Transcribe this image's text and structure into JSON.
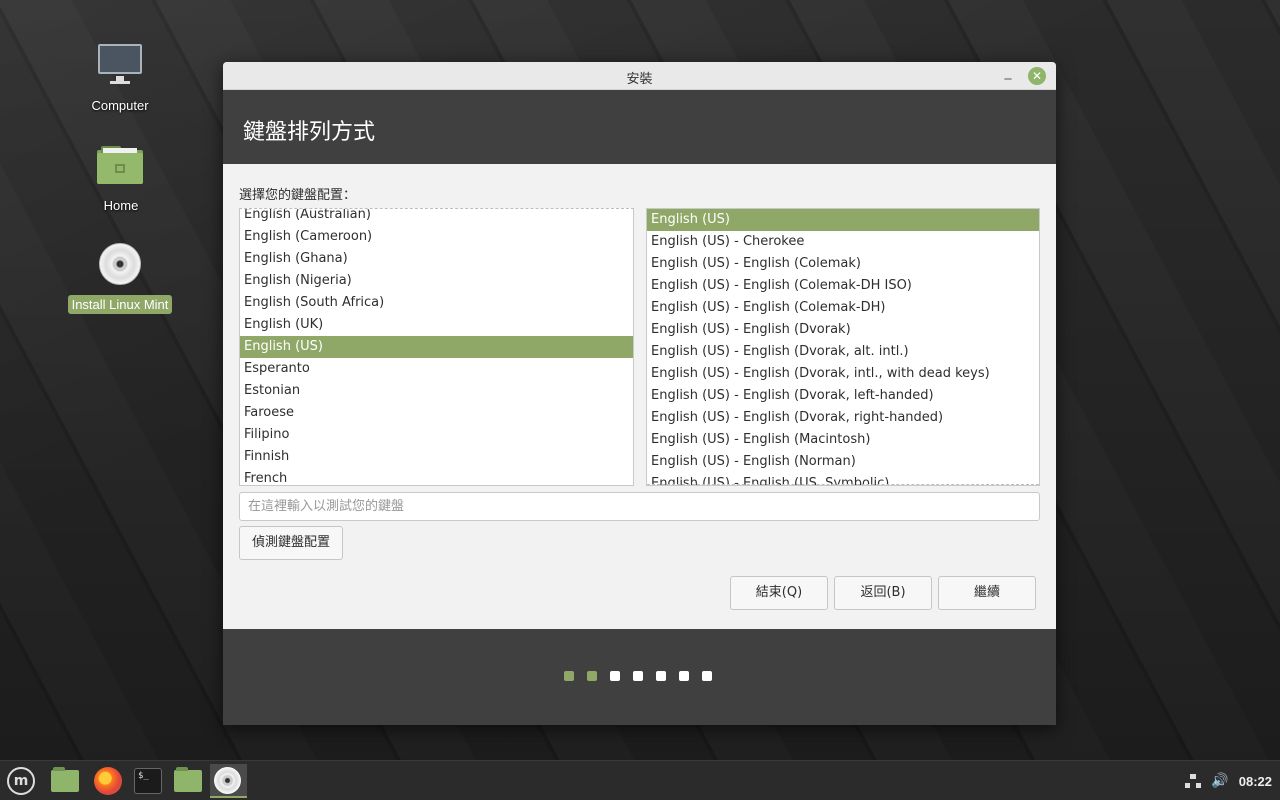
{
  "desktop": {
    "icons": [
      {
        "label": "Computer",
        "icon": "computer-icon"
      },
      {
        "label": "Home",
        "icon": "home-folder-icon"
      },
      {
        "label": "Install Linux Mint",
        "icon": "install-disc-icon"
      }
    ]
  },
  "window": {
    "title": "安裝",
    "minimize_label": "_",
    "close_label": "✕",
    "header_title": "鍵盤排列方式",
    "prompt": "選擇您的鍵盤配置：",
    "layouts": [
      "English (Australian)",
      "English (Cameroon)",
      "English (Ghana)",
      "English (Nigeria)",
      "English (South Africa)",
      "English (UK)",
      "English (US)",
      "Esperanto",
      "Estonian",
      "Faroese",
      "Filipino",
      "Finnish",
      "French"
    ],
    "selected_layout": "English (US)",
    "variants": [
      "English (US)",
      "English (US) - Cherokee",
      "English (US) - English (Colemak)",
      "English (US) - English (Colemak-DH ISO)",
      "English (US) - English (Colemak-DH)",
      "English (US) - English (Dvorak)",
      "English (US) - English (Dvorak, alt. intl.)",
      "English (US) - English (Dvorak, intl., with dead keys)",
      "English (US) - English (Dvorak, left-handed)",
      "English (US) - English (Dvorak, right-handed)",
      "English (US) - English (Macintosh)",
      "English (US) - English (Norman)",
      "English (US) - English (US, Symbolic)"
    ],
    "selected_variant": "English (US)",
    "test_placeholder": "在這裡輸入以測試您的鍵盤",
    "test_value": "",
    "detect_button": "偵測鍵盤配置",
    "quit_button": "結束(Q)",
    "back_button": "返回(B)",
    "continue_button": "繼續",
    "progress": {
      "total_steps": 7,
      "completed_steps": 2
    }
  },
  "taskbar": {
    "menu_glyph": "m",
    "apps": [
      "files-icon",
      "firefox-icon",
      "terminal-icon",
      "files-icon",
      "installer-disc-icon"
    ],
    "terminal_glyph": "$_",
    "volume_glyph": "🔊",
    "clock": "08:22"
  },
  "colors": {
    "accent": "#8fa868",
    "header_bg": "#404040",
    "window_bg": "#f2f2f2"
  }
}
